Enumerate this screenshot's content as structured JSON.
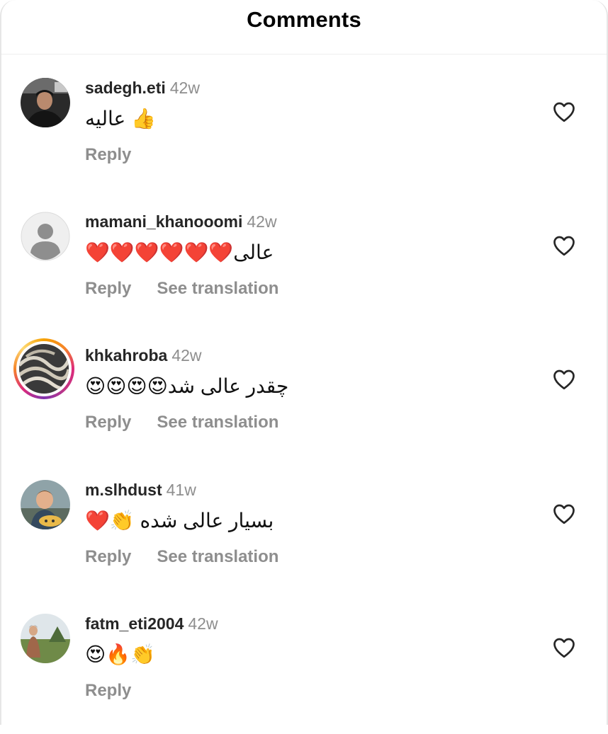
{
  "header": {
    "title": "Comments"
  },
  "comments": [
    {
      "username": "sadegh.eti",
      "time": "42w",
      "text": "عالیه 👍",
      "reply_label": "Reply",
      "translation_label": "",
      "avatar": "photo-man-dark",
      "story_ring": false
    },
    {
      "username": "mamani_khanooomi",
      "time": "42w",
      "text": "❤️❤️❤️❤️❤️❤️عالی",
      "reply_label": "Reply",
      "translation_label": "See translation",
      "avatar": "default-person-icon",
      "story_ring": false
    },
    {
      "username": "khkahroba",
      "time": "42w",
      "text": "😍😍😍😍چقدر عالی شد",
      "reply_label": "Reply",
      "translation_label": "See translation",
      "avatar": "photo-pattern",
      "story_ring": true
    },
    {
      "username": "m.slhdust",
      "time": "41w",
      "text": "❤️👏 بسیار عالی شده",
      "reply_label": "Reply",
      "translation_label": "See translation",
      "avatar": "photo-child",
      "story_ring": false
    },
    {
      "username": "fatm_eti2004",
      "time": "42w",
      "text": "😍🔥👏",
      "reply_label": "Reply",
      "translation_label": "",
      "avatar": "photo-landscape",
      "story_ring": false
    }
  ],
  "colors": {
    "meta_gray": "#8e8e8e",
    "username": "#262626",
    "heart_outline": "#262626"
  }
}
